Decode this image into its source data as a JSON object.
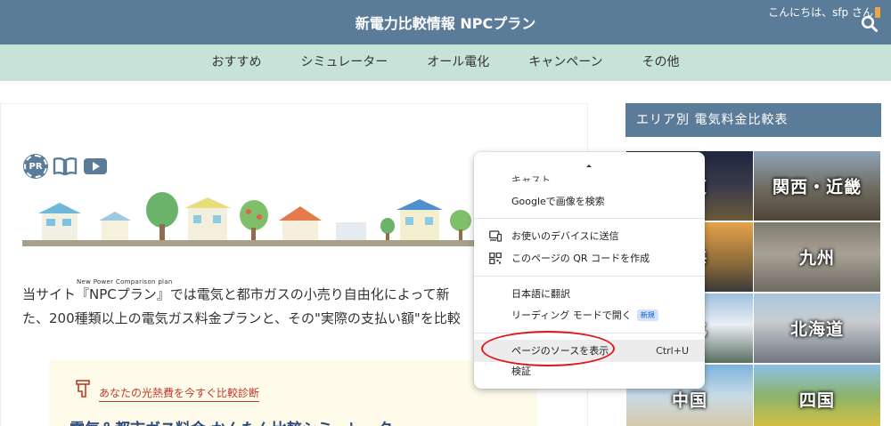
{
  "header": {
    "site_title": "新電力比較情報 NPCプラン",
    "greeting": "こんにちは、sfp さん",
    "search_icon": "search-icon"
  },
  "nav": {
    "items": [
      "おすすめ",
      "シミュレーター",
      "オール電化",
      "キャンペーン",
      "その他"
    ]
  },
  "main": {
    "pr_badge": "PR",
    "icons": [
      "pr-badge",
      "book-icon",
      "play-icon"
    ],
    "tagline": "New Power Comparison plan",
    "intro_line1": "当サイト『NPCプラン』では電気と都市ガスの小売り自由化によって新",
    "intro_line2": "た、200種類以上の電気ガス料金プランと、その\"実際の支払い額\"を比較",
    "promo_label": "あなたの光熱費を今すぐ比較診断",
    "promo_title": "電気＆都市ガス料金 かんたん比較シミュレーター"
  },
  "sidebar": {
    "heading": "エリア別 電気料金比較表",
    "tiles": [
      "関東",
      "関西・近畿",
      "東海",
      "九州",
      "東北",
      "北海道",
      "中国",
      "四国"
    ]
  },
  "context_menu": {
    "cut_item": "キャスト...",
    "items": [
      {
        "label": "Googleで画像を検索",
        "icon": ""
      },
      {
        "label": "お使いのデバイスに送信",
        "icon": "device-icon"
      },
      {
        "label": "このページの QR コードを作成",
        "icon": "qr-icon"
      },
      {
        "label": "日本語に翻訳",
        "icon": ""
      },
      {
        "label": "リーディング モードで開く",
        "icon": "",
        "badge": "新規"
      },
      {
        "label": "ページのソースを表示",
        "icon": "",
        "shortcut": "Ctrl+U"
      },
      {
        "label": "検証",
        "icon": ""
      }
    ]
  },
  "colors": {
    "header": "#5b7c99",
    "nav": "#c6e2d9",
    "annotation": "#e3141b"
  }
}
